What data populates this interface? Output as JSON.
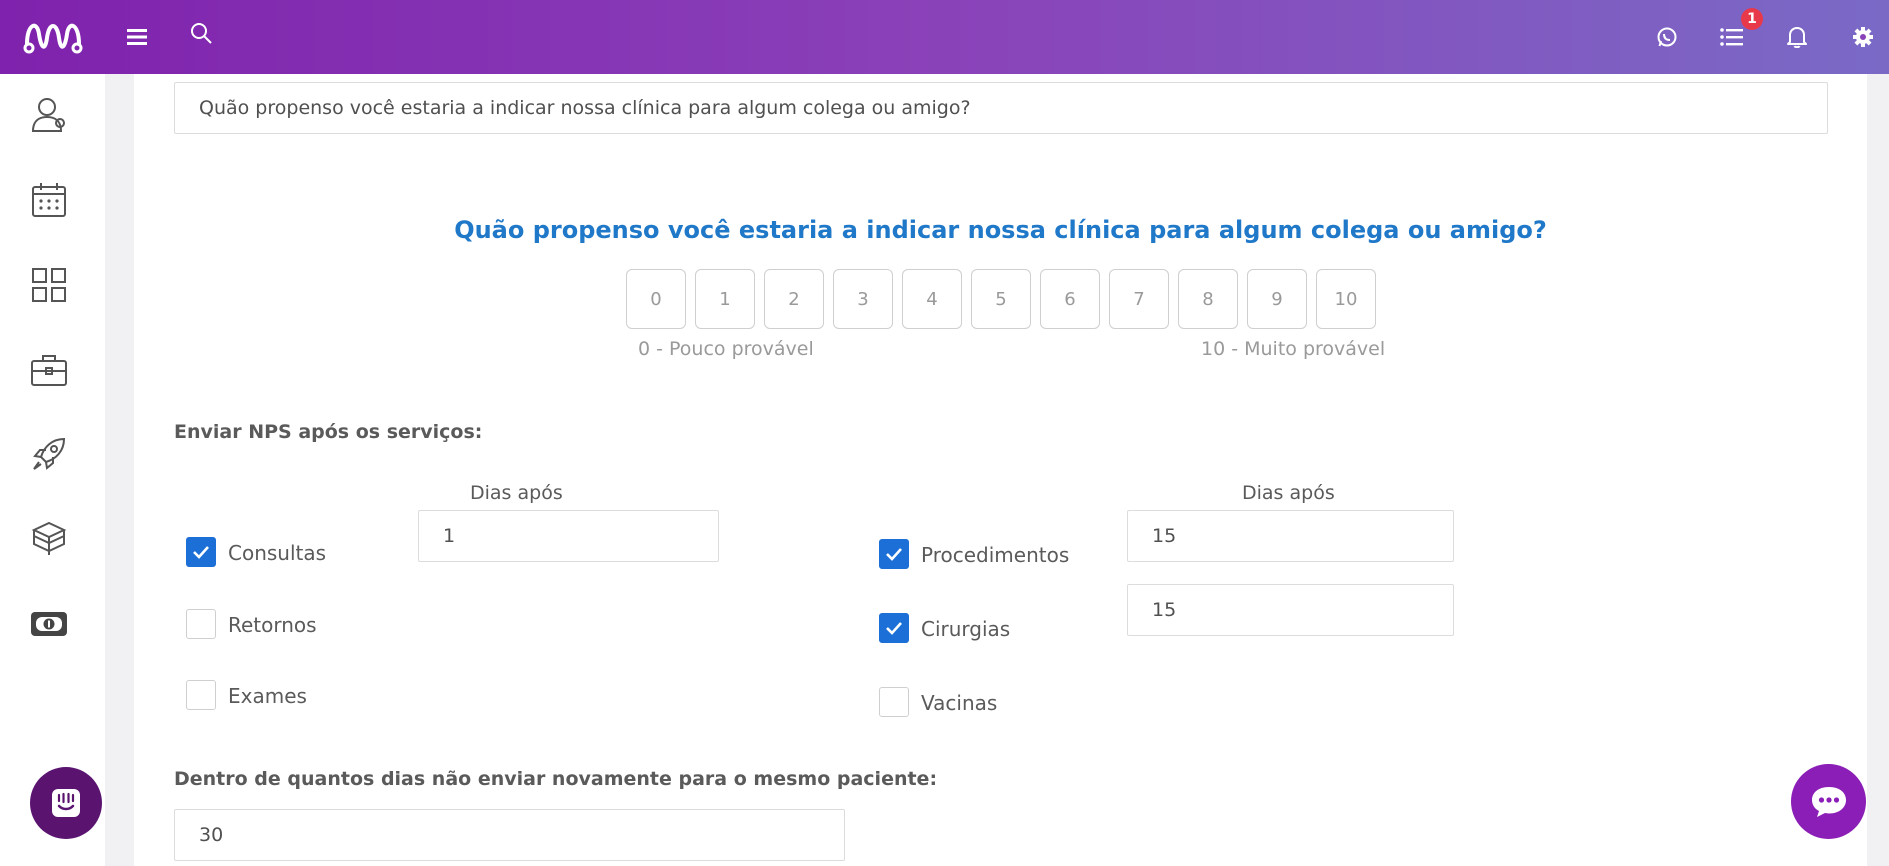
{
  "topbar": {
    "notification_count": "1",
    "colors": {
      "gradient_start": "#7f22ad",
      "gradient_end": "#7a6ac6",
      "badge": "#e8394a"
    },
    "icons": [
      "logo-icon",
      "menu-icon",
      "search-icon",
      "whatsapp-icon",
      "tasks-list-icon",
      "bell-icon",
      "gear-icon"
    ]
  },
  "sidebar": {
    "icons": [
      "patients-icon",
      "calendar-icon",
      "apps-grid-icon",
      "briefcase-icon",
      "rocket-icon",
      "boxes-icon",
      "money-icon"
    ]
  },
  "question_input": {
    "value": "Quão propenso você estaria a indicar nossa clínica para algum colega ou amigo?"
  },
  "preview": {
    "title": "Quão propenso você estaria a indicar nossa clínica para algum colega ou amigo?",
    "scores": [
      "0",
      "1",
      "2",
      "3",
      "4",
      "5",
      "6",
      "7",
      "8",
      "9",
      "10"
    ],
    "low_label": "0 - Pouco provável",
    "high_label": "10 - Muito provável",
    "title_color": "#1f78c8"
  },
  "services": {
    "label": "Enviar NPS após os serviços:",
    "days_header_left": "Dias após",
    "days_header_right": "Dias após",
    "consultas": {
      "label": "Consultas",
      "checked": true,
      "days": "1"
    },
    "retornos": {
      "label": "Retornos",
      "checked": false
    },
    "exames": {
      "label": "Exames",
      "checked": false
    },
    "procedimentos": {
      "label": "Procedimentos",
      "checked": true,
      "days": "15"
    },
    "cirurgias": {
      "label": "Cirurgias",
      "checked": true,
      "days": "15"
    },
    "vacinas": {
      "label": "Vacinas",
      "checked": false
    },
    "checkbox_color": "#1c6fd6"
  },
  "resend": {
    "label": "Dentro de quantos dias não enviar novamente para o mesmo paciente:",
    "value": "30"
  },
  "fab": {
    "left_icon": "intercom-icon",
    "right_icon": "chat-bubble-icon"
  }
}
